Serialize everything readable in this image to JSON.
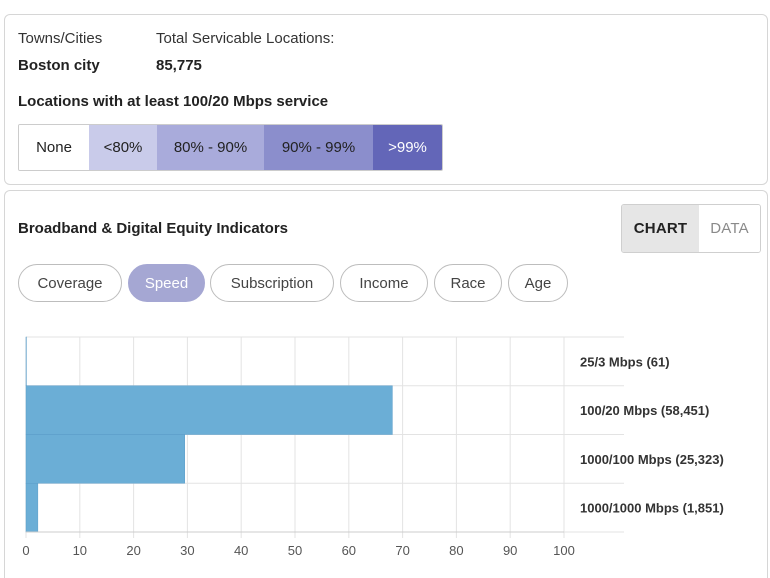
{
  "summary": {
    "place_label": "Towns/Cities",
    "place_value": "Boston city",
    "locations_label": "Total Servicable Locations:",
    "locations_value": "85,775",
    "legend_title": "Locations with at least 100/20 Mbps service",
    "legend": [
      {
        "label": "None",
        "color": "#ffffff",
        "text_color": "#222222"
      },
      {
        "label": "<80%",
        "color": "#c9cbea",
        "text_color": "#222222"
      },
      {
        "label": "80% - 90%",
        "color": "#a9abdb",
        "text_color": "#222222"
      },
      {
        "label": "90% - 99%",
        "color": "#8b8ecc",
        "text_color": "#222222"
      },
      {
        "label": ">99%",
        "color": "#6366b8",
        "text_color": "#ffffff"
      }
    ]
  },
  "panel": {
    "title": "Broadband & Digital Equity Indicators",
    "view_toggle": {
      "chart": "CHART",
      "data": "DATA",
      "selected": "CHART"
    },
    "tabs": [
      {
        "label": "Coverage",
        "active": false
      },
      {
        "label": "Speed",
        "active": true
      },
      {
        "label": "Subscription",
        "active": false
      },
      {
        "label": "Income",
        "active": false
      },
      {
        "label": "Race",
        "active": false
      },
      {
        "label": "Age",
        "active": false
      }
    ]
  },
  "chart_data": {
    "type": "bar",
    "orientation": "horizontal",
    "categories": [
      "25/3 Mbps (61)",
      "100/20 Mbps (58,451)",
      "1000/100 Mbps (25,323)",
      "1000/1000 Mbps (1,851)"
    ],
    "values": [
      0.07,
      68.1,
      29.5,
      2.2
    ],
    "xlim": [
      0,
      100
    ],
    "xticks": [
      0,
      10,
      20,
      30,
      40,
      50,
      60,
      70,
      80,
      90,
      100
    ],
    "grid": true,
    "bar_color": "#6baed6",
    "category_labels_position": "right"
  }
}
